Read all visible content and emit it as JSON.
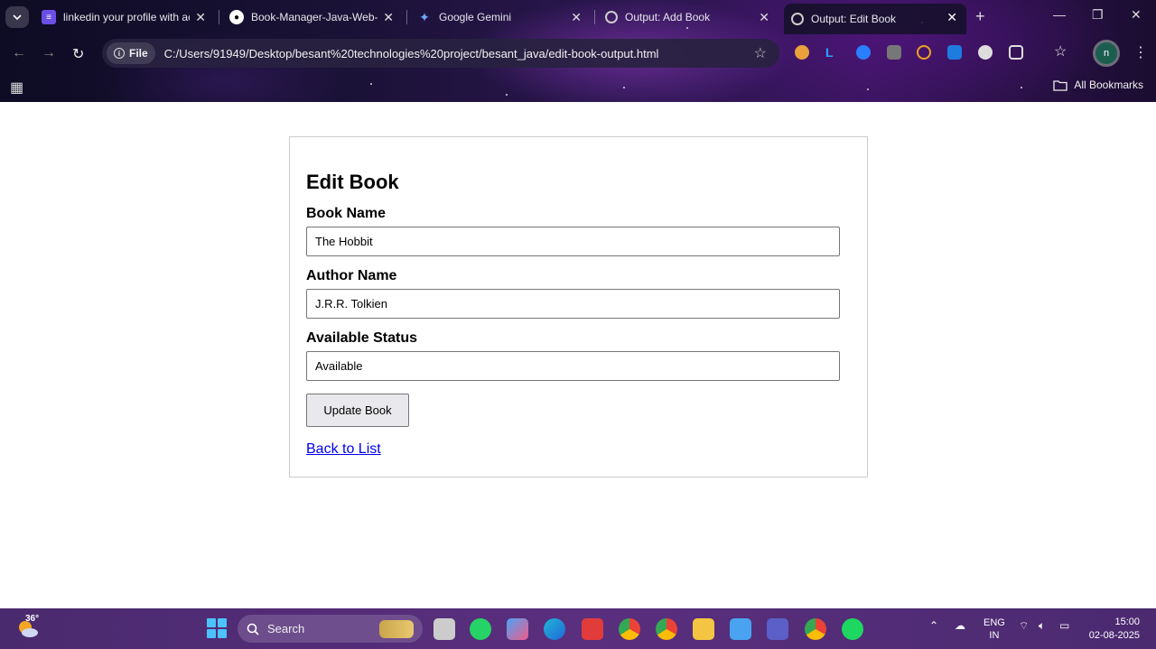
{
  "browser": {
    "tabs": [
      {
        "title": "linkedin your profile with ac",
        "icon": "forms-icon",
        "color": "#6b4ee6"
      },
      {
        "title": "Book-Manager-Java-Web-Ap",
        "icon": "github-icon",
        "color": "#ffffff"
      },
      {
        "title": "Google Gemini",
        "icon": "gemini-icon",
        "color": "#6fa8ff"
      },
      {
        "title": "Output: Add Book",
        "icon": "globe-icon",
        "color": "#cccccc"
      },
      {
        "title": "Output: Edit Book",
        "icon": "globe-icon",
        "color": "#cccccc"
      }
    ],
    "address": {
      "scheme_chip": "File",
      "url": "C:/Users/91949/Desktop/besant%20technologies%20project/besant_java/edit-book-output.html"
    },
    "profile_initial": "n",
    "bookmarks_label": "All Bookmarks"
  },
  "page": {
    "heading": "Edit Book",
    "fields": [
      {
        "label": "Book Name",
        "value": "The Hobbit"
      },
      {
        "label": "Author Name",
        "value": "J.R.R. Tolkien"
      },
      {
        "label": "Available Status",
        "value": "Available"
      }
    ],
    "submit_label": "Update Book",
    "back_link": "Back to List"
  },
  "taskbar": {
    "temperature": "36°",
    "search_placeholder": "Search",
    "language": {
      "line1": "ENG",
      "line2": "IN"
    },
    "time": "15:00",
    "date": "02-08-2025"
  }
}
